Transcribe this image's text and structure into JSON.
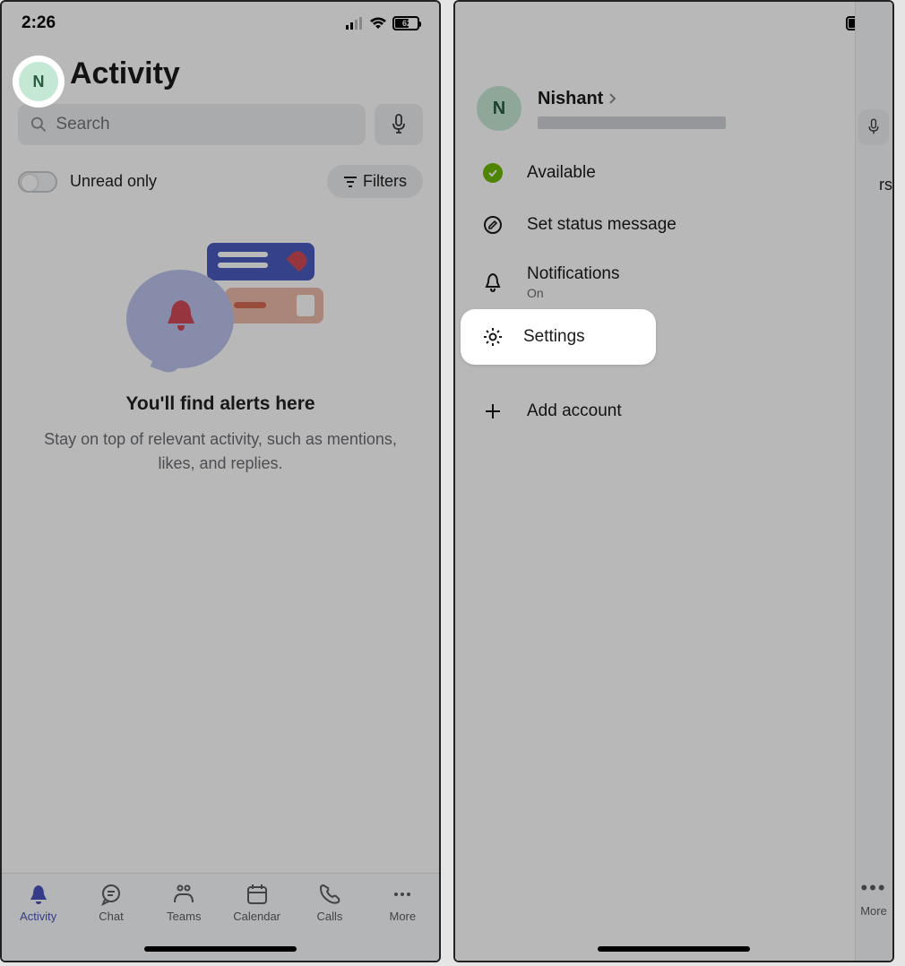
{
  "status": {
    "time": "2:26",
    "battery": "62"
  },
  "left": {
    "avatar_initial": "N",
    "title": "Activity",
    "search_placeholder": "Search",
    "unread_label": "Unread only",
    "filters_label": "Filters",
    "empty_heading": "You'll find alerts here",
    "empty_body": "Stay on top of relevant activity, such as mentions, likes, and replies.",
    "tabs": [
      {
        "label": "Activity"
      },
      {
        "label": "Chat"
      },
      {
        "label": "Teams"
      },
      {
        "label": "Calendar"
      },
      {
        "label": "Calls"
      },
      {
        "label": "More"
      }
    ]
  },
  "right": {
    "avatar_initial": "N",
    "profile_name": "Nishant",
    "menu": {
      "available": "Available",
      "set_status": "Set status message",
      "notifications": "Notifications",
      "notifications_sub": "On",
      "settings": "Settings",
      "add_account": "Add account"
    },
    "strip": {
      "filters": "rs",
      "more": "More"
    }
  }
}
